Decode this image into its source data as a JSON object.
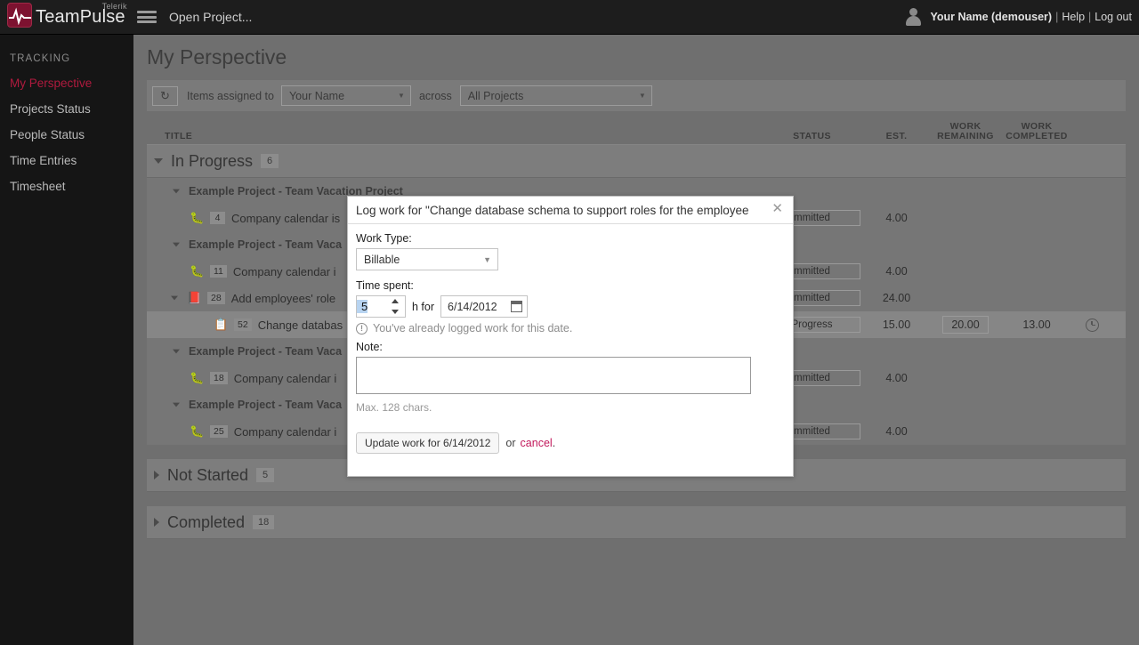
{
  "header": {
    "logo_name": "TeamPulse",
    "logo_super": "Telerik",
    "menu_icon": "hamburger-icon",
    "open_project": "Open Project...",
    "user_name": "Your Name (demouser)",
    "sep1": "|",
    "sep2": "|",
    "help": "Help",
    "logout": "Log out"
  },
  "sidebar": {
    "group_label": "TRACKING",
    "items": [
      {
        "label": "My Perspective",
        "active": true
      },
      {
        "label": "Projects Status",
        "active": false
      },
      {
        "label": "People Status",
        "active": false
      },
      {
        "label": "Time Entries",
        "active": false
      },
      {
        "label": "Timesheet",
        "active": false
      }
    ]
  },
  "main": {
    "page_title": "My Perspective",
    "filter": {
      "refresh_icon": "refresh-icon",
      "assigned_label": "Items assigned to",
      "user_value": "Your Name",
      "across_label": "across",
      "project_value": "All Projects"
    },
    "columns": {
      "title": "TITLE",
      "status": "STATUS",
      "est": "EST.",
      "work_remaining_l1": "WORK",
      "work_remaining_l2": "REMAINING",
      "work_completed_l1": "WORK",
      "work_completed_l2": "COMPLETED"
    },
    "groups": [
      {
        "name": "In Progress",
        "count": "6",
        "expanded": true,
        "blocks": [
          {
            "project": "Example Project - Team Vacation Project",
            "rows": [
              {
                "icon": "bug-icon",
                "id": "4",
                "title": "Company calendar is",
                "status": "mmitted",
                "est": "4.00",
                "remaining": "",
                "completed": "",
                "selected": false,
                "level": 1,
                "clock": false
              }
            ]
          },
          {
            "project": "Example Project - Team Vaca",
            "rows": [
              {
                "icon": "bug-icon",
                "id": "11",
                "title": "Company calendar i",
                "status": "mmitted",
                "est": "4.00",
                "remaining": "",
                "completed": "",
                "selected": false,
                "level": 1,
                "clock": false
              },
              {
                "icon": "story-icon",
                "id": "28",
                "title": "Add employees' role",
                "status": "mmitted",
                "est": "24.00",
                "remaining": "",
                "completed": "",
                "selected": false,
                "level": 1,
                "clock": false
              },
              {
                "icon": "task-icon",
                "id": "52",
                "title": "Change databas",
                "status": "Progress",
                "est": "15.00",
                "remaining": "20.00",
                "completed": "13.00",
                "selected": true,
                "level": 2,
                "clock": true
              }
            ]
          },
          {
            "project": "Example Project - Team Vaca",
            "rows": [
              {
                "icon": "bug-icon",
                "id": "18",
                "title": "Company calendar i",
                "status": "mmitted",
                "est": "4.00",
                "remaining": "",
                "completed": "",
                "selected": false,
                "level": 1,
                "clock": false
              }
            ]
          },
          {
            "project": "Example Project - Team Vaca",
            "rows": [
              {
                "icon": "bug-icon",
                "id": "25",
                "title": "Company calendar i",
                "status": "mmitted",
                "est": "4.00",
                "remaining": "",
                "completed": "",
                "selected": false,
                "level": 1,
                "clock": false
              }
            ]
          }
        ]
      },
      {
        "name": "Not Started",
        "count": "5",
        "expanded": false,
        "blocks": []
      },
      {
        "name": "Completed",
        "count": "18",
        "expanded": false,
        "blocks": []
      }
    ]
  },
  "modal": {
    "title": "Log work for \"Change database schema to support roles for the employee",
    "close_icon": "close-icon",
    "work_type_label": "Work Type:",
    "work_type_value": "Billable",
    "time_spent_label": "Time spent:",
    "time_value": "5",
    "h_for": "h for",
    "date_value": "6/14/2012",
    "calendar_icon": "calendar-icon",
    "warning_icon": "warning-icon",
    "warning_text": "You've already logged work for this date.",
    "note_label": "Note:",
    "note_value": "",
    "max_chars": "Max. 128 chars.",
    "update_button": "Update work for 6/14/2012",
    "or_text": "or",
    "cancel_link": "cancel",
    "period": "."
  },
  "colors": {
    "accent": "#b01a3e",
    "cancel": "#c2185b",
    "topbar": "#1d1d1d",
    "sidebar": "#151515",
    "page_bg": "#6f6f6f"
  }
}
